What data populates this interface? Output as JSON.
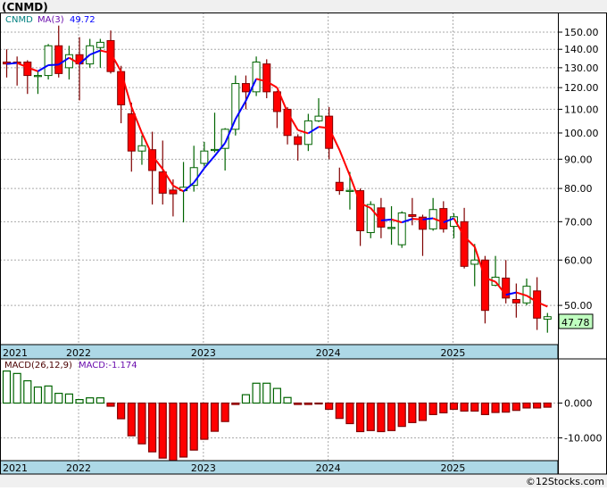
{
  "title": "(CNMD)",
  "legend": {
    "symbol": "CNMD",
    "ma_label": "MA(3)",
    "ma_value": "49.72"
  },
  "macd_legend": {
    "label": "MACD(26,12,9)",
    "value_label": "MACD:-1.174"
  },
  "last_price_label": "47.78",
  "footer": "©12Stocks.com",
  "colors": {
    "up": "#006400",
    "down": "#ff0000",
    "down_outline": "#800000",
    "ma_up": "#0000ff",
    "ma_down": "#ff0000",
    "axis_band": "#add8e6",
    "last_price_bg": "#c0ffc0"
  },
  "chart_data": [
    {
      "type": "candlestick",
      "interval": "monthly",
      "y_scale": "log",
      "ylim": [
        44,
        158
      ],
      "y_ticks": [
        "150.00",
        "140.00",
        "130.00",
        "120.00",
        "110.00",
        "100.00",
        "90.00",
        "80.00",
        "70.00",
        "60.00",
        "50.00"
      ],
      "x_ticks": [
        "2021",
        "2022",
        "2023",
        "2024",
        "2025"
      ],
      "grid": true,
      "overlay": "MA(3)",
      "candles_fields": [
        "month",
        "open",
        "high",
        "low",
        "close"
      ],
      "candles": [
        [
          "2021-06",
          133,
          140,
          125,
          132
        ],
        [
          "2021-07",
          133,
          136,
          121,
          132.5
        ],
        [
          "2021-08",
          133,
          134,
          117,
          126
        ],
        [
          "2021-09",
          126,
          128,
          117,
          126
        ],
        [
          "2021-10",
          126,
          143,
          124,
          142
        ],
        [
          "2021-11",
          142,
          154,
          125,
          127
        ],
        [
          "2021-12",
          130,
          142,
          124,
          137
        ],
        [
          "2022-01",
          137,
          147,
          114,
          132
        ],
        [
          "2022-02",
          132,
          146,
          130,
          142
        ],
        [
          "2022-03",
          141,
          146,
          130,
          144
        ],
        [
          "2022-04",
          145,
          151,
          127,
          128
        ],
        [
          "2022-05",
          128,
          131,
          104,
          112
        ],
        [
          "2022-06",
          108,
          113,
          85.6,
          93
        ],
        [
          "2022-07",
          93,
          99,
          88,
          95
        ],
        [
          "2022-08",
          93.5,
          100.5,
          75,
          86
        ],
        [
          "2022-09",
          85.5,
          97,
          75,
          78.5
        ],
        [
          "2022-10",
          79.5,
          83,
          71.5,
          78.3
        ],
        [
          "2022-11",
          79.3,
          89,
          69.8,
          80.4
        ],
        [
          "2022-12",
          81,
          95,
          79,
          87
        ],
        [
          "2023-01",
          88.5,
          96.5,
          87.5,
          93
        ],
        [
          "2023-02",
          93.5,
          108.5,
          92.5,
          93.6
        ],
        [
          "2023-03",
          94,
          102,
          86,
          101.5
        ],
        [
          "2023-04",
          101.5,
          126,
          99,
          122
        ],
        [
          "2023-05",
          122,
          126,
          110,
          118
        ],
        [
          "2023-06",
          118,
          136,
          116,
          133
        ],
        [
          "2023-07",
          132,
          134.5,
          115,
          118
        ],
        [
          "2023-08",
          118,
          118.5,
          102,
          109
        ],
        [
          "2023-09",
          110,
          111,
          95.5,
          99
        ],
        [
          "2023-10",
          98.5,
          99.5,
          89.5,
          95.5
        ],
        [
          "2023-11",
          95.5,
          108,
          93,
          105
        ],
        [
          "2023-12",
          105,
          115,
          104.5,
          107
        ],
        [
          "2024-01",
          107,
          111,
          90,
          94
        ],
        [
          "2024-02",
          82,
          87,
          78,
          79.3
        ],
        [
          "2024-03",
          79.3,
          85.5,
          73.5,
          79.4
        ],
        [
          "2024-04",
          79.3,
          80,
          63.5,
          67.5
        ],
        [
          "2024-05",
          67,
          76,
          65.5,
          75
        ],
        [
          "2024-06",
          74,
          77,
          65.5,
          68.5
        ],
        [
          "2024-07",
          68.3,
          74.5,
          63.8,
          68.4
        ],
        [
          "2024-08",
          63.8,
          73,
          63,
          72.5
        ],
        [
          "2024-09",
          72,
          77,
          69,
          71.5
        ],
        [
          "2024-10",
          71.3,
          72,
          61,
          67.9
        ],
        [
          "2024-11",
          68,
          77,
          67.5,
          73.5
        ],
        [
          "2024-12",
          73.8,
          76,
          67,
          68
        ],
        [
          "2025-01",
          68.7,
          72.4,
          65.5,
          71.4
        ],
        [
          "2025-02",
          70,
          74,
          58,
          58.5
        ],
        [
          "2025-03",
          59,
          64,
          54,
          60
        ],
        [
          "2025-04",
          60,
          61,
          46.5,
          49
        ],
        [
          "2025-05",
          54.2,
          61,
          54,
          56
        ],
        [
          "2025-06",
          55.8,
          60,
          50.4,
          51.5
        ],
        [
          "2025-07",
          51.2,
          54.6,
          47.6,
          50.5
        ],
        [
          "2025-08",
          50.5,
          55.7,
          50,
          54
        ],
        [
          "2025-09",
          53,
          56,
          45.3,
          47.5
        ],
        [
          "2025-10",
          47.3,
          48.5,
          44.8,
          47.78
        ]
      ]
    },
    {
      "type": "bar",
      "name": "MACD(26,12,9)",
      "ylim": [
        -17,
        10
      ],
      "y_ticks": [
        "0.000",
        "-10.000"
      ],
      "x_ticks": [
        "2021",
        "2022",
        "2023",
        "2024",
        "2025"
      ],
      "values": [
        9.2,
        8.5,
        6.4,
        4.6,
        4.9,
        2.8,
        2.6,
        1.0,
        1.5,
        1.5,
        -0.9,
        -4.5,
        -9.4,
        -11.7,
        -14,
        -15.8,
        -16.5,
        -15.5,
        -13.5,
        -10.4,
        -8.1,
        -5.3,
        -0.4,
        2.4,
        5.7,
        5.7,
        4.2,
        1.6,
        -0.4,
        -0.4,
        -0.1,
        -1.8,
        -4.4,
        -5.9,
        -8.2,
        -7.9,
        -8.2,
        -7.9,
        -6.7,
        -5.6,
        -5.0,
        -3.3,
        -2.8,
        -1.8,
        -2.3,
        -2.3,
        -3.3,
        -2.7,
        -2.6,
        -2.1,
        -1.4,
        -1.4,
        -1.174
      ]
    }
  ]
}
